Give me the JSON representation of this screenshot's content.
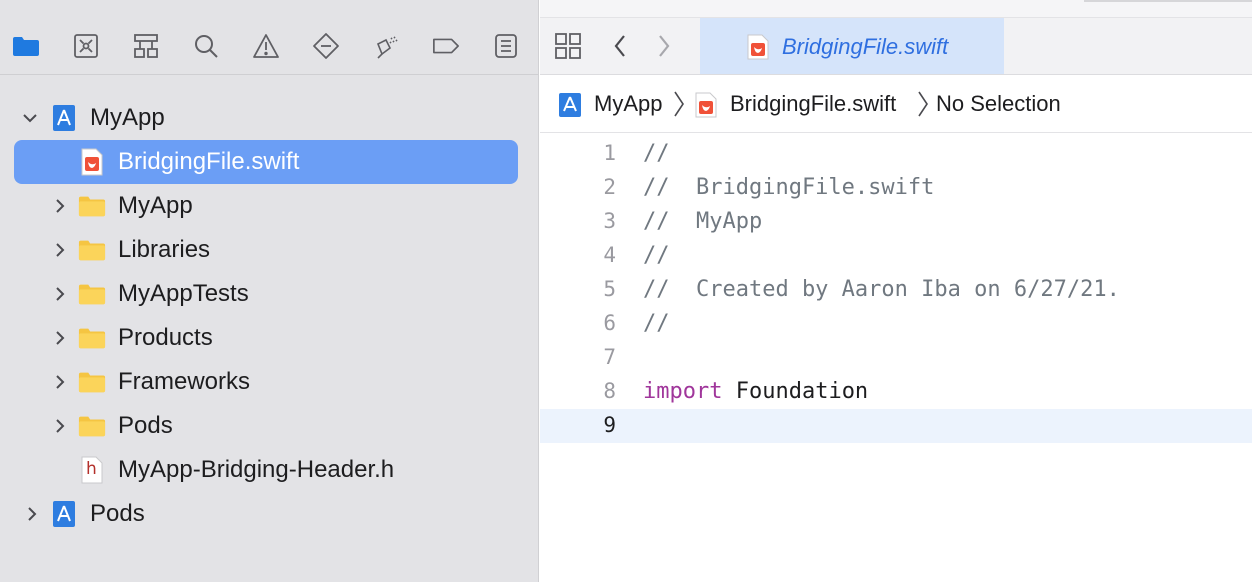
{
  "navigator": {
    "toolbar_icons": [
      "folder-icon",
      "source-control-icon",
      "symbol-icon",
      "search-icon",
      "warning-icon",
      "test-icon",
      "debug-icon",
      "breakpoint-icon",
      "report-icon"
    ],
    "tree": [
      {
        "label": "MyApp",
        "type": "project",
        "expanded": true
      },
      {
        "label": "BridgingFile.swift",
        "type": "swift-file",
        "selected": true
      },
      {
        "label": "MyApp",
        "type": "folder"
      },
      {
        "label": "Libraries",
        "type": "folder"
      },
      {
        "label": "MyAppTests",
        "type": "folder"
      },
      {
        "label": "Products",
        "type": "folder"
      },
      {
        "label": "Frameworks",
        "type": "folder"
      },
      {
        "label": "Pods",
        "type": "folder"
      },
      {
        "label": "MyApp-Bridging-Header.h",
        "type": "header-file",
        "icon_letter": "h"
      },
      {
        "label": "Pods",
        "type": "project",
        "expanded": false
      }
    ]
  },
  "editor": {
    "tab": {
      "label": "BridgingFile.swift"
    },
    "jumpbar": {
      "project": "MyApp",
      "file": "BridgingFile.swift",
      "selection": "No Selection"
    },
    "lines": [
      {
        "n": "1",
        "text": "//"
      },
      {
        "n": "2",
        "text": "//  BridgingFile.swift"
      },
      {
        "n": "3",
        "text": "//  MyApp"
      },
      {
        "n": "4",
        "text": "//"
      },
      {
        "n": "5",
        "text": "//  Created by Aaron Iba on 6/27/21."
      },
      {
        "n": "6",
        "text": "//"
      },
      {
        "n": "7",
        "text": ""
      },
      {
        "n": "8",
        "keyword": "import",
        "text": " Foundation"
      },
      {
        "n": "9",
        "text": ""
      }
    ],
    "current_line": "9"
  },
  "colors": {
    "selection": "#6b9ef5",
    "tab_background": "#d5e4fa",
    "tab_text": "#2f6fe0",
    "keyword": "#a0369b",
    "comment": "#707880",
    "folder": "#f5c542",
    "accent_blue": "#1f7ae0"
  }
}
